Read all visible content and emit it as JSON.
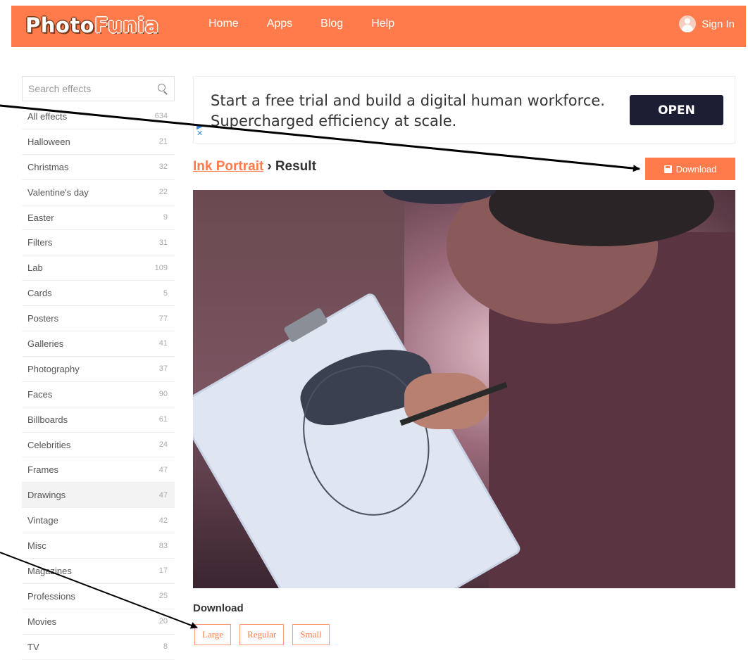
{
  "header": {
    "logo_part1": "Photo",
    "logo_part2": "Funia",
    "nav": [
      "Home",
      "Apps",
      "Blog",
      "Help"
    ],
    "signin_label": "Sign In",
    "colors": {
      "brand": "#ff7b4c"
    }
  },
  "sidebar": {
    "search_placeholder": "Search effects",
    "categories": [
      {
        "label": "All effects",
        "count": "634"
      },
      {
        "label": "Halloween",
        "count": "21"
      },
      {
        "label": "Christmas",
        "count": "32"
      },
      {
        "label": "Valentine's day",
        "count": "22"
      },
      {
        "label": "Easter",
        "count": "9"
      },
      {
        "label": "Filters",
        "count": "31"
      },
      {
        "label": "Lab",
        "count": "109"
      },
      {
        "label": "Cards",
        "count": "5"
      },
      {
        "label": "Posters",
        "count": "77"
      },
      {
        "label": "Galleries",
        "count": "41"
      },
      {
        "label": "Photography",
        "count": "37"
      },
      {
        "label": "Faces",
        "count": "90"
      },
      {
        "label": "Billboards",
        "count": "61"
      },
      {
        "label": "Celebrities",
        "count": "24"
      },
      {
        "label": "Frames",
        "count": "47"
      },
      {
        "label": "Drawings",
        "count": "47"
      },
      {
        "label": "Vintage",
        "count": "42"
      },
      {
        "label": "Misc",
        "count": "83"
      },
      {
        "label": "Magazines",
        "count": "17"
      },
      {
        "label": "Professions",
        "count": "25"
      },
      {
        "label": "Movies",
        "count": "20"
      },
      {
        "label": "TV",
        "count": "8"
      }
    ],
    "active_index": 15
  },
  "ad": {
    "text": "Start a free trial and build a digital human workforce. Supercharged efficiency at scale.",
    "button": "OPEN"
  },
  "main": {
    "effect_link": "Ink Portrait",
    "separator": "›",
    "current": "Result",
    "download_button": "Download",
    "download_heading": "Download",
    "sizes": [
      "Large",
      "Regular",
      "Small"
    ]
  }
}
